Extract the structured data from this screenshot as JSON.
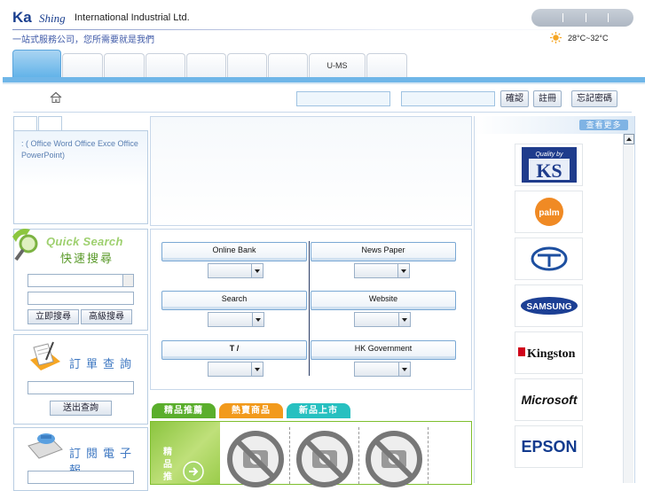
{
  "header": {
    "logo_ka": "Ka",
    "logo_shing": "Shing",
    "logo_rest": "International Industrial Ltd.",
    "slogan": "一站式服務公司，您所需要就是我們",
    "weather": "28°C~32°C"
  },
  "tabs": [
    "",
    "",
    "",
    "",
    "",
    "",
    "",
    "U-MS",
    ""
  ],
  "login": {
    "confirm": "確認",
    "register": "註冊",
    "forgot": "忘記密碼"
  },
  "info_box": {
    "text": ":  (  Office Word Office Exce Office PowerPoint)"
  },
  "quick_search": {
    "title": "Quick Search",
    "subtitle": "快速搜尋",
    "search_btn": "立即搜尋",
    "advanced_btn": "高級搜尋"
  },
  "order_query": {
    "title": "訂單查詢",
    "submit_btn": "送出查詢"
  },
  "newsletter": {
    "title": "訂閱電子報"
  },
  "links": [
    {
      "label": "Online Bank"
    },
    {
      "label": "News Paper"
    },
    {
      "label": "Search"
    },
    {
      "label": "Website"
    },
    {
      "label": "T  /"
    },
    {
      "label": "HK Government"
    }
  ],
  "product_tabs": [
    {
      "label": "精品推薦",
      "color": "#5aae2c"
    },
    {
      "label": "熱賣商品",
      "color": "#f29a1c"
    },
    {
      "label": "新品上市",
      "color": "#27c0c0"
    }
  ],
  "product_side": "精品推",
  "brands": {
    "more": "查看更多",
    "items": [
      {
        "name": "Quality by KS",
        "icon": "ks-logo"
      },
      {
        "name": "palm",
        "icon": "palm-logo"
      },
      {
        "name": "T",
        "icon": "toshiba-logo"
      },
      {
        "name": "SAMSUNG",
        "icon": "samsung-logo"
      },
      {
        "name": "Kingston",
        "icon": "kingston-logo"
      },
      {
        "name": "Microsoft",
        "icon": "microsoft-logo"
      },
      {
        "name": "EPSON",
        "icon": "epson-logo"
      }
    ]
  },
  "colors": {
    "brand_blue": "#1a3f8f",
    "nav_blue": "#6fb6e8",
    "quick_green": "#9ed06f"
  }
}
